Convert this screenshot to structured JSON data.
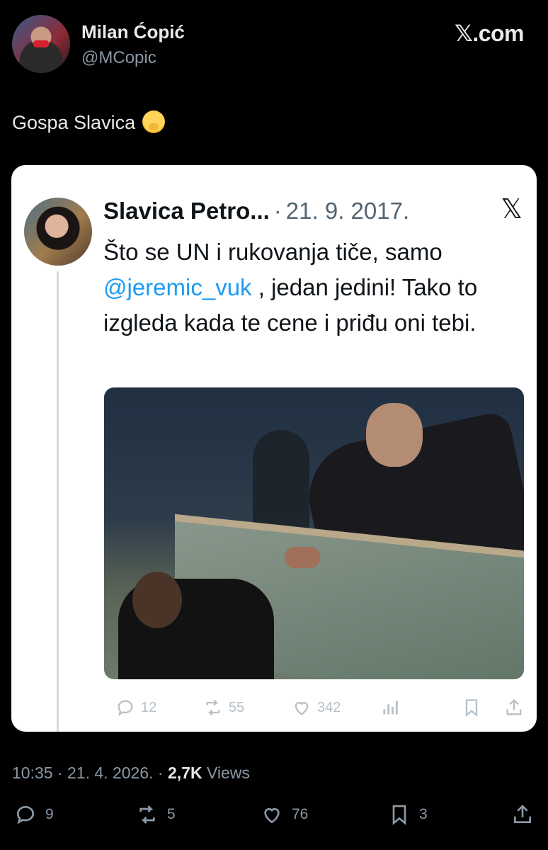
{
  "author": {
    "name": "Milan Ćopić",
    "handle": "@MCopic"
  },
  "brand": "𝕏.com",
  "tweet": {
    "text": "Gospa Slavica",
    "emoji": "face-with-hand-over-mouth"
  },
  "quoted": {
    "name": "Slavica Petro...",
    "separator": "·",
    "date": "21. 9. 2017.",
    "text_before": "Što se UN i rukovanja tiče, samo ",
    "mention": "@jeremic_vuk",
    "text_after": " , jedan jedini! Tako to izgleda kada te cene i priđu oni tebi.",
    "x_glyph": "𝕏",
    "actions": {
      "replies": "12",
      "retweets": "55",
      "likes": "342"
    }
  },
  "meta": {
    "time": "10:35",
    "sep1": " · ",
    "date": "21. 4. 2026.",
    "sep2": " · ",
    "views_count": "2,7K",
    "views_label": " Views"
  },
  "actions": {
    "replies": "9",
    "retweets": "5",
    "likes": "76",
    "bookmarks": "3"
  },
  "colors": {
    "background": "#000000",
    "card": "#ffffff",
    "link": "#1d9bf0",
    "muted": "#8b98a5"
  }
}
